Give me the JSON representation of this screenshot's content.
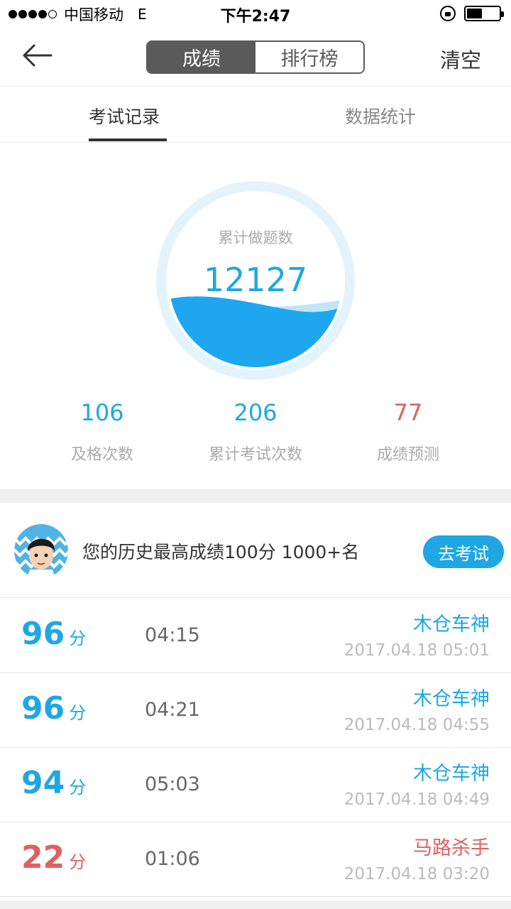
{
  "status_bar": {
    "carrier": "中国移动",
    "network": "E",
    "time": "下午2:47"
  },
  "nav": {
    "segments": [
      "成绩",
      "排行榜"
    ],
    "active_segment": "成绩",
    "clear_label": "清空"
  },
  "tabs": [
    "考试记录",
    "数据统计"
  ],
  "stats": {
    "gauge_label": "累计做题数",
    "gauge_value": "12127",
    "items": [
      {
        "value": "106",
        "label": "及格次数"
      },
      {
        "value": "206",
        "label": "累计考试次数"
      },
      {
        "value": "77",
        "label": "成绩预测"
      }
    ]
  },
  "best": {
    "text": "您的历史最高成绩100分 1000+名",
    "button_label": "去考试"
  },
  "records": [
    {
      "score": "96",
      "unit": "分",
      "duration": "04:15",
      "title": "木仓车神",
      "date": "2017.04.18 05:01",
      "status": "good"
    },
    {
      "score": "96",
      "unit": "分",
      "duration": "04:21",
      "title": "木仓车神",
      "date": "2017.04.18 04:55",
      "status": "good"
    },
    {
      "score": "94",
      "unit": "分",
      "duration": "05:03",
      "title": "木仓车神",
      "date": "2017.04.18 04:49",
      "status": "good"
    },
    {
      "score": "22",
      "unit": "分",
      "duration": "01:06",
      "title": "马路杀手",
      "date": "2017.04.18 03:20",
      "status": "bad"
    }
  ],
  "colors": {
    "accent": "#1ea7e4",
    "fail": "#e06060",
    "segment": "#5a5a5a"
  }
}
